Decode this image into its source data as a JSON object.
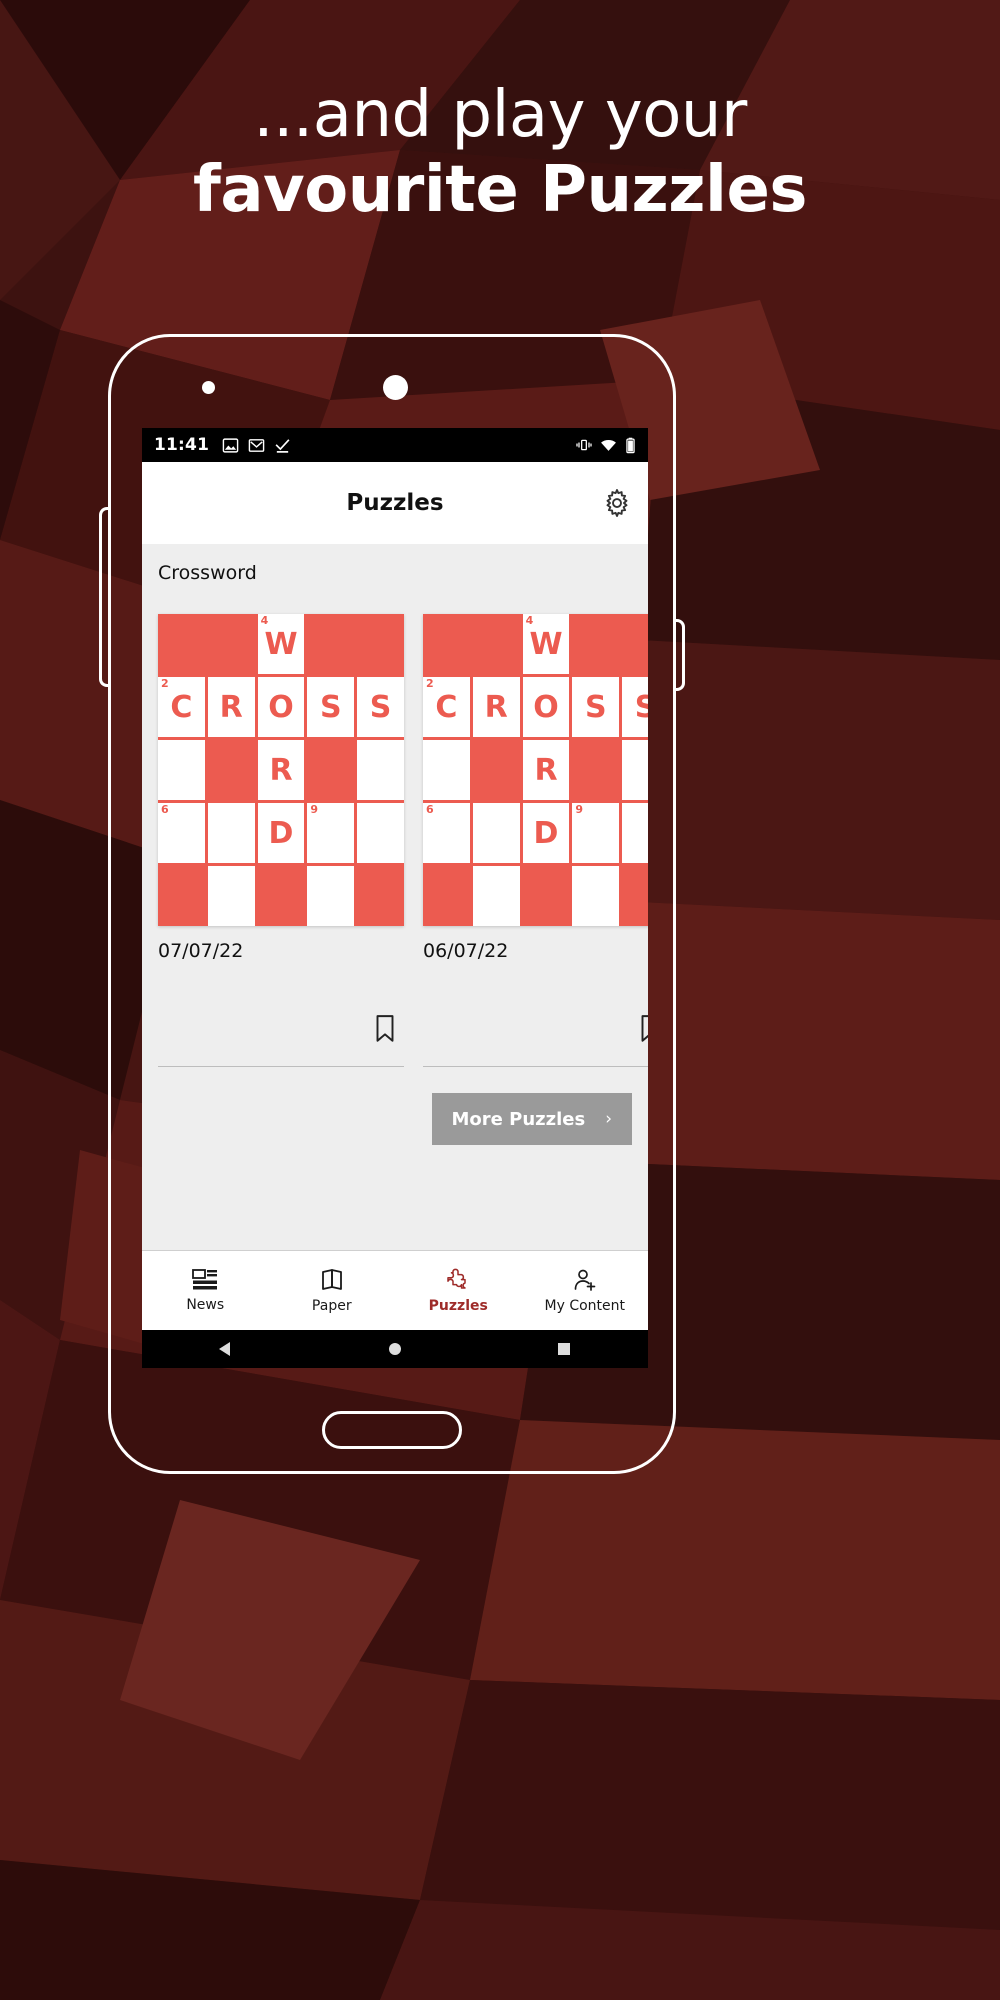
{
  "promo": {
    "line1": "...and play your",
    "line2": "favourite Puzzles",
    "background_color": "#3a100e"
  },
  "phone": {
    "statusbar": {
      "time": "11:41",
      "left_icons": [
        "image-icon",
        "gmail-icon",
        "checkmark-icon"
      ],
      "right_icons": [
        "vibrate-icon",
        "wifi-icon",
        "battery-icon"
      ],
      "background_color": "#000000"
    },
    "appbar": {
      "title": "Puzzles",
      "settings_icon": "gear-icon"
    },
    "content": {
      "section_title": "Crossword",
      "accent_color": "#ec5b50",
      "background_color": "#eeeeee",
      "cards": [
        {
          "date": "07/07/22",
          "bookmark_icon": "bookmark-icon",
          "grid": {
            "rows": 5,
            "cols": 5,
            "cells": [
              [
                {
                  "t": "open"
                },
                {
                  "t": "block"
                },
                {
                  "t": "open",
                  "letter": "W",
                  "num": "4"
                },
                {
                  "t": "block"
                },
                {
                  "t": "block"
                }
              ],
              [
                {
                  "t": "open",
                  "letter": "C",
                  "num": "2"
                },
                {
                  "t": "open",
                  "letter": "R"
                },
                {
                  "t": "open",
                  "letter": "O"
                },
                {
                  "t": "open",
                  "letter": "S"
                },
                {
                  "t": "open",
                  "letter": "S"
                }
              ],
              [
                {
                  "t": "open"
                },
                {
                  "t": "block"
                },
                {
                  "t": "open",
                  "letter": "R"
                },
                {
                  "t": "block"
                },
                {
                  "t": "open"
                }
              ],
              [
                {
                  "t": "open",
                  "num": "6"
                },
                {
                  "t": "open"
                },
                {
                  "t": "open",
                  "letter": "D"
                },
                {
                  "t": "open",
                  "num": "9"
                },
                {
                  "t": "open"
                }
              ],
              [
                {
                  "t": "block"
                },
                {
                  "t": "open"
                },
                {
                  "t": "block"
                },
                {
                  "t": "open"
                },
                {
                  "t": "block"
                }
              ]
            ]
          }
        },
        {
          "date": "06/07/22",
          "bookmark_icon": "bookmark-icon",
          "grid": {
            "rows": 5,
            "cols": 5,
            "cells": [
              [
                {
                  "t": "open"
                },
                {
                  "t": "block"
                },
                {
                  "t": "open",
                  "letter": "W",
                  "num": "4"
                },
                {
                  "t": "block"
                },
                {
                  "t": "block"
                }
              ],
              [
                {
                  "t": "open",
                  "letter": "C",
                  "num": "2"
                },
                {
                  "t": "open",
                  "letter": "R"
                },
                {
                  "t": "open",
                  "letter": "O"
                },
                {
                  "t": "open",
                  "letter": "S"
                },
                {
                  "t": "open",
                  "letter": "S"
                }
              ],
              [
                {
                  "t": "open"
                },
                {
                  "t": "block"
                },
                {
                  "t": "open",
                  "letter": "R"
                },
                {
                  "t": "block"
                },
                {
                  "t": "open"
                }
              ],
              [
                {
                  "t": "open",
                  "num": "6"
                },
                {
                  "t": "open"
                },
                {
                  "t": "open",
                  "letter": "D"
                },
                {
                  "t": "open",
                  "num": "9"
                },
                {
                  "t": "open"
                }
              ],
              [
                {
                  "t": "block"
                },
                {
                  "t": "open"
                },
                {
                  "t": "block"
                },
                {
                  "t": "open"
                },
                {
                  "t": "block"
                }
              ]
            ]
          }
        }
      ],
      "more_button": {
        "label": "More Puzzles",
        "chevron": "›",
        "background_color": "#9a9a9a"
      }
    },
    "bottom_nav": {
      "active_color": "#9e2b29",
      "items": [
        {
          "label": "News",
          "icon": "news-layout-icon",
          "active": false
        },
        {
          "label": "Paper",
          "icon": "newspaper-fold-icon",
          "active": false
        },
        {
          "label": "Puzzles",
          "icon": "puzzle-piece-icon",
          "active": true
        },
        {
          "label": "My Content",
          "icon": "person-add-icon",
          "active": false
        }
      ]
    },
    "android_nav": {
      "back_icon": "triangle-back-icon",
      "home_icon": "circle-home-icon",
      "recents_icon": "square-recents-icon"
    }
  }
}
